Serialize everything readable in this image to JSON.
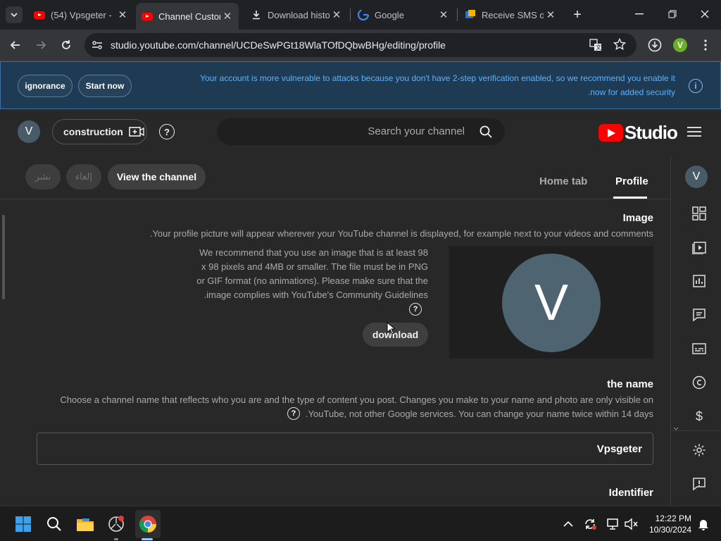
{
  "browser": {
    "tabs": [
      {
        "label": "(54) Vpsgeter - ",
        "icon": "youtube-icon",
        "active": false
      },
      {
        "label": "Channel Custom",
        "icon": "youtube-icon",
        "active": true
      },
      {
        "label": "Download histo",
        "icon": "download-icon",
        "active": false
      },
      {
        "label": "Google",
        "icon": "google-icon",
        "active": false
      },
      {
        "label": "Receive SMS o",
        "icon": "sms-icon",
        "active": false
      }
    ],
    "url": "studio.youtube.com/channel/UCDeSwPGt18WlaTOfDQbwBHg/editing/profile",
    "profile_initial": "V"
  },
  "banner": {
    "button_ignore": "ignorance",
    "button_start": "Start now",
    "line1": "Your account is more vulnerable to attacks because you don't have 2-step verification enabled, so we recommend you enable it",
    "line2": ".now for added security"
  },
  "studio": {
    "avatar_initial": "V",
    "create_label": "construction",
    "search_placeholder": "Search your channel",
    "logo_text": "Studio",
    "action_publish": "نشر",
    "action_cancel": "إلغاء",
    "action_view": "View the channel",
    "tab_home": "Home tab",
    "tab_profile": "Profile",
    "image_title": "Image",
    "image_desc": ".Your profile picture will appear wherever your YouTube channel is displayed, for example next to your videos and comments",
    "image_rec": [
      "We recommend that you use an image that is at least 98",
      "x 98 pixels and 4MB or smaller. The file must be in PNG",
      "or GIF format (no animations). Please make sure that the",
      ".image complies with YouTube's Community Guidelines"
    ],
    "upload_label": "download",
    "preview_initial": "V",
    "name_title": "the name",
    "name_desc1": "Choose a channel name that reflects who you are and the type of content you post. Changes you make to your name and photo are only visible on",
    "name_desc2": ".YouTube, not other Google services. You can change your name twice within 14 days",
    "name_value": "Vpsgeter",
    "identifier_title": "Identifier",
    "rail_avatar": "V"
  },
  "taskbar": {
    "time": "12:22 PM",
    "date": "10/30/2024"
  },
  "colors": {
    "youtube_red": "#ff0000",
    "banner_link": "#5bb3ff",
    "chrome_green": "#6cad2a"
  }
}
